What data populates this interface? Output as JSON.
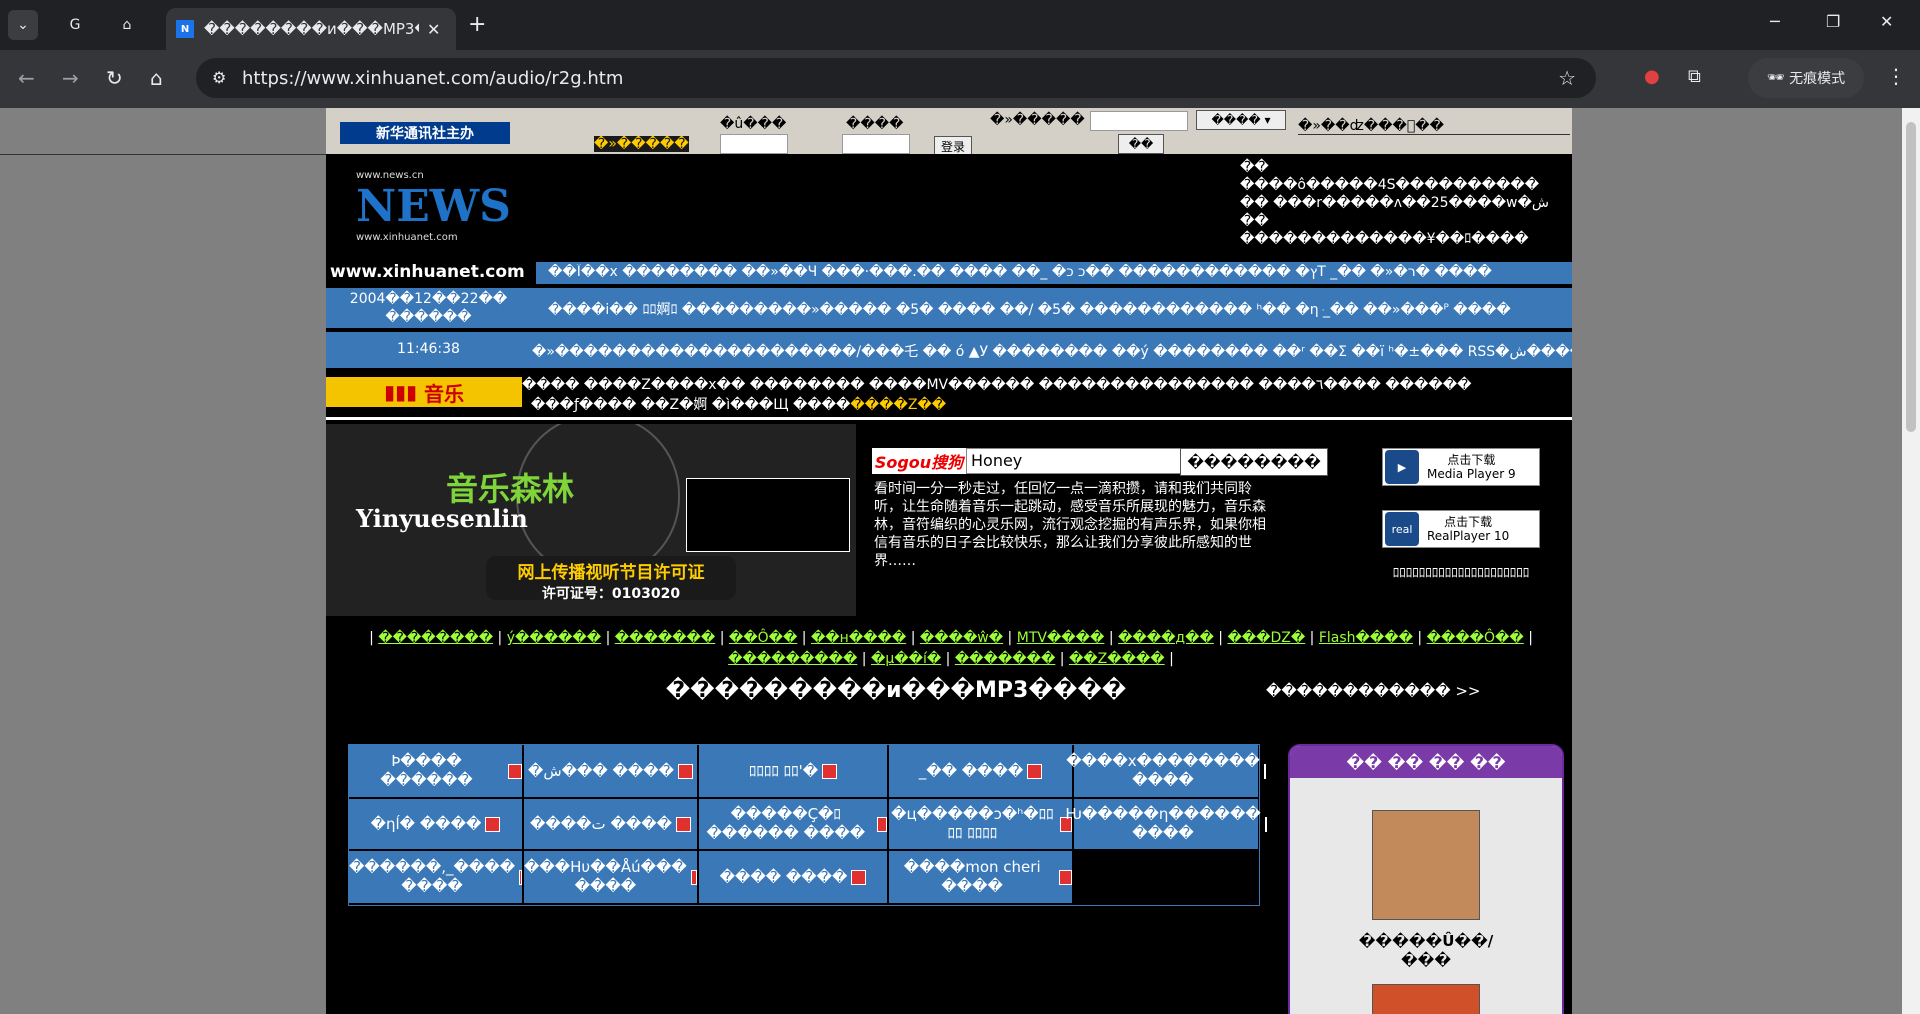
{
  "browser": {
    "tab_title": "��������и���MP3��",
    "url": "https://www.xinhuanet.com/audio/r2g.htm",
    "incognito_label": "无痕模式",
    "new_tab": "+",
    "close": "✕"
  },
  "topbar": {
    "logo": "新华通讯社主办",
    "label1": "�û���",
    "label2": "����",
    "label3": "�»�����",
    "label4": "�»�����",
    "select": "����",
    "label5": "�»��ʣ���ͨ��",
    "login": "登录",
    "btn2": "��"
  },
  "header": {
    "logo_news": "NEWS",
    "logo_small1": "www.news.cn",
    "logo_small2": "www.xinhuanet.com",
    "site": "www.xinhuanet.com",
    "lines": [
      "��",
      "����ô�����4S����������",
      "�� ���r�����ʌ��25����w�ش",
      "��",
      "�������������¥��ﾛ����"
    ]
  },
  "nav": {
    "row1": "��Ï��x �������� ��»��Ч ���·���.�� ���� ��_ �ץ� ������������ ��כ כT _�� �»�ר� ����",
    "date": "2004��12��22��",
    "weekday": "������",
    "row2": "����i�� ﾛﾛ婀ﾛ ���������»����� �5� ���� ��/ �5� ������������ ʰ�� �ηּ _�� ��»���ᴾ ����",
    "time": "11:46:38",
    "row3": "�»���������������������/���乇 �� ό ▲У �������� ��ý �������� ��ʳ ��Σ ��ï ʰ�±��� RSS�ش�����"
  },
  "music": {
    "label": "音乐",
    "line1": "����   ����Z����x��   ��������   ����MV������   ���������������   ����٦����   ������",
    "line2_a": "���ƒ����   ��Z�婀   �ì���Щ ����",
    "line2_b": "����Z��"
  },
  "banner": {
    "title1": "Yinyuesenlin",
    "title2": "音乐森林",
    "license1": "网上传播视听节目许可证",
    "license2": "许可证号：0103020"
  },
  "search": {
    "logo": "Sogou搜狗",
    "value": "Honey",
    "button": "��������",
    "intro": "看时间一分一秒走过，任回忆一点一滴积攒，请和我们共同聆听，让生命随着音乐一起跳动，感受音乐所展现的魅力，音乐森林，音符编织的心灵乐网，流行观念挖掘的有声乐界，如果你相信有音乐的日子会比较快乐，那么让我们分享彼此所感知的世界……"
  },
  "downloads": {
    "mp_title": "点击下载",
    "mp_sub": "Media Player 9",
    "real_title": "点击下载",
    "real_sub": "RealPlayer 10",
    "real_icon": "real",
    "caption": "ﾛﾛﾛﾛﾛﾛﾛﾛﾛﾛﾛﾛﾛﾛﾛﾛﾛﾛﾛﾛﾛ"
  },
  "categories": {
    "row1": [
      "��������",
      "ý������",
      "�������",
      "��Ô��",
      "��н����",
      "����ŵ�",
      "MTV����",
      "����д��",
      "���DZ�",
      "Flash����",
      "����Ô��"
    ],
    "row2": [
      "���������",
      "�µ��í�",
      "�������",
      "��Z����"
    ]
  },
  "section": {
    "title": "���������и���MP3����",
    "more": "������������ >>"
  },
  "grid": [
    [
      "Þ���� ������",
      "�ش��� ����",
      "ﾛﾛﾛﾛ ﾛﾛ'�",
      "_�� ����",
      "����x�������� ����"
    ],
    [
      "�ηĺ� ����",
      "����ت ����",
      "�����Ç�ﾛ������ ����",
      "�ц�����ɔ�ʰ�ﾛﾛﾛﾛ ﾛﾛﾛﾛ",
      "Ƕ�����η������ ����"
    ],
    [
      "������,_���� ����",
      "���Hυ��Åú��� ����",
      "���� ����",
      "����mon cheri ����",
      ""
    ]
  ],
  "side": {
    "title": "�� �� �� ��",
    "singer": "�����Û��/",
    "singer2": "���"
  }
}
